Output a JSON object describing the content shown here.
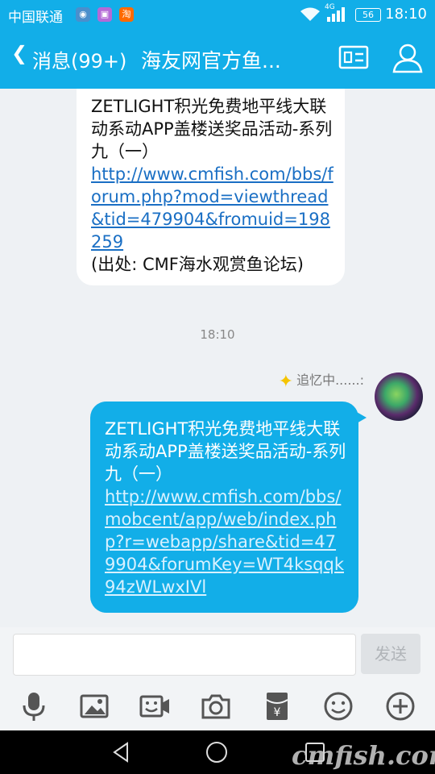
{
  "status_bar": {
    "carrier": "中国联通",
    "network": "4G",
    "battery": "56",
    "time": "18:10",
    "app_icons": [
      "globe-icon",
      "gallery-icon",
      "taobao-icon"
    ]
  },
  "header": {
    "back_label": "消息(99+)",
    "title": "海友网官方鱼...",
    "icons": [
      "profile-card-icon",
      "contacts-icon"
    ]
  },
  "messages": {
    "incoming": {
      "text": "ZETLIGHT积光免费地平线大联动系动APP盖楼送奖品活动-系列九（一）",
      "link": "http://www.cmfish.com/bbs/forum.php?mod=viewthread&tid=479904&fromuid=198259",
      "source": "(出处: CMF海水观赏鱼论坛)"
    },
    "timestamp": "18:10",
    "sender_name": "追忆中......:",
    "outgoing": {
      "text": "ZETLIGHT积光免费地平线大联动系动APP盖楼送奖品活动-系列九（一）",
      "link": "http://www.cmfish.com/bbs/mobcent/app/web/index.php?r=webapp/share&tid=479904&forumKey=WT4ksqqk94zWLwxIVl"
    }
  },
  "input_bar": {
    "placeholder": "",
    "send_label": "发送"
  },
  "toolbar": {
    "icons": [
      "microphone-icon",
      "image-icon",
      "video-call-icon",
      "camera-icon",
      "red-packet-icon",
      "emoji-icon",
      "plus-icon"
    ]
  },
  "nav": {
    "icons": [
      "back-triangle-icon",
      "home-circle-icon",
      "recent-square-icon"
    ]
  },
  "watermark": "cmfish.com",
  "colors": {
    "accent": "#12aee8",
    "incoming_bubble": "#ffffff",
    "link": "#1a6fc4"
  }
}
